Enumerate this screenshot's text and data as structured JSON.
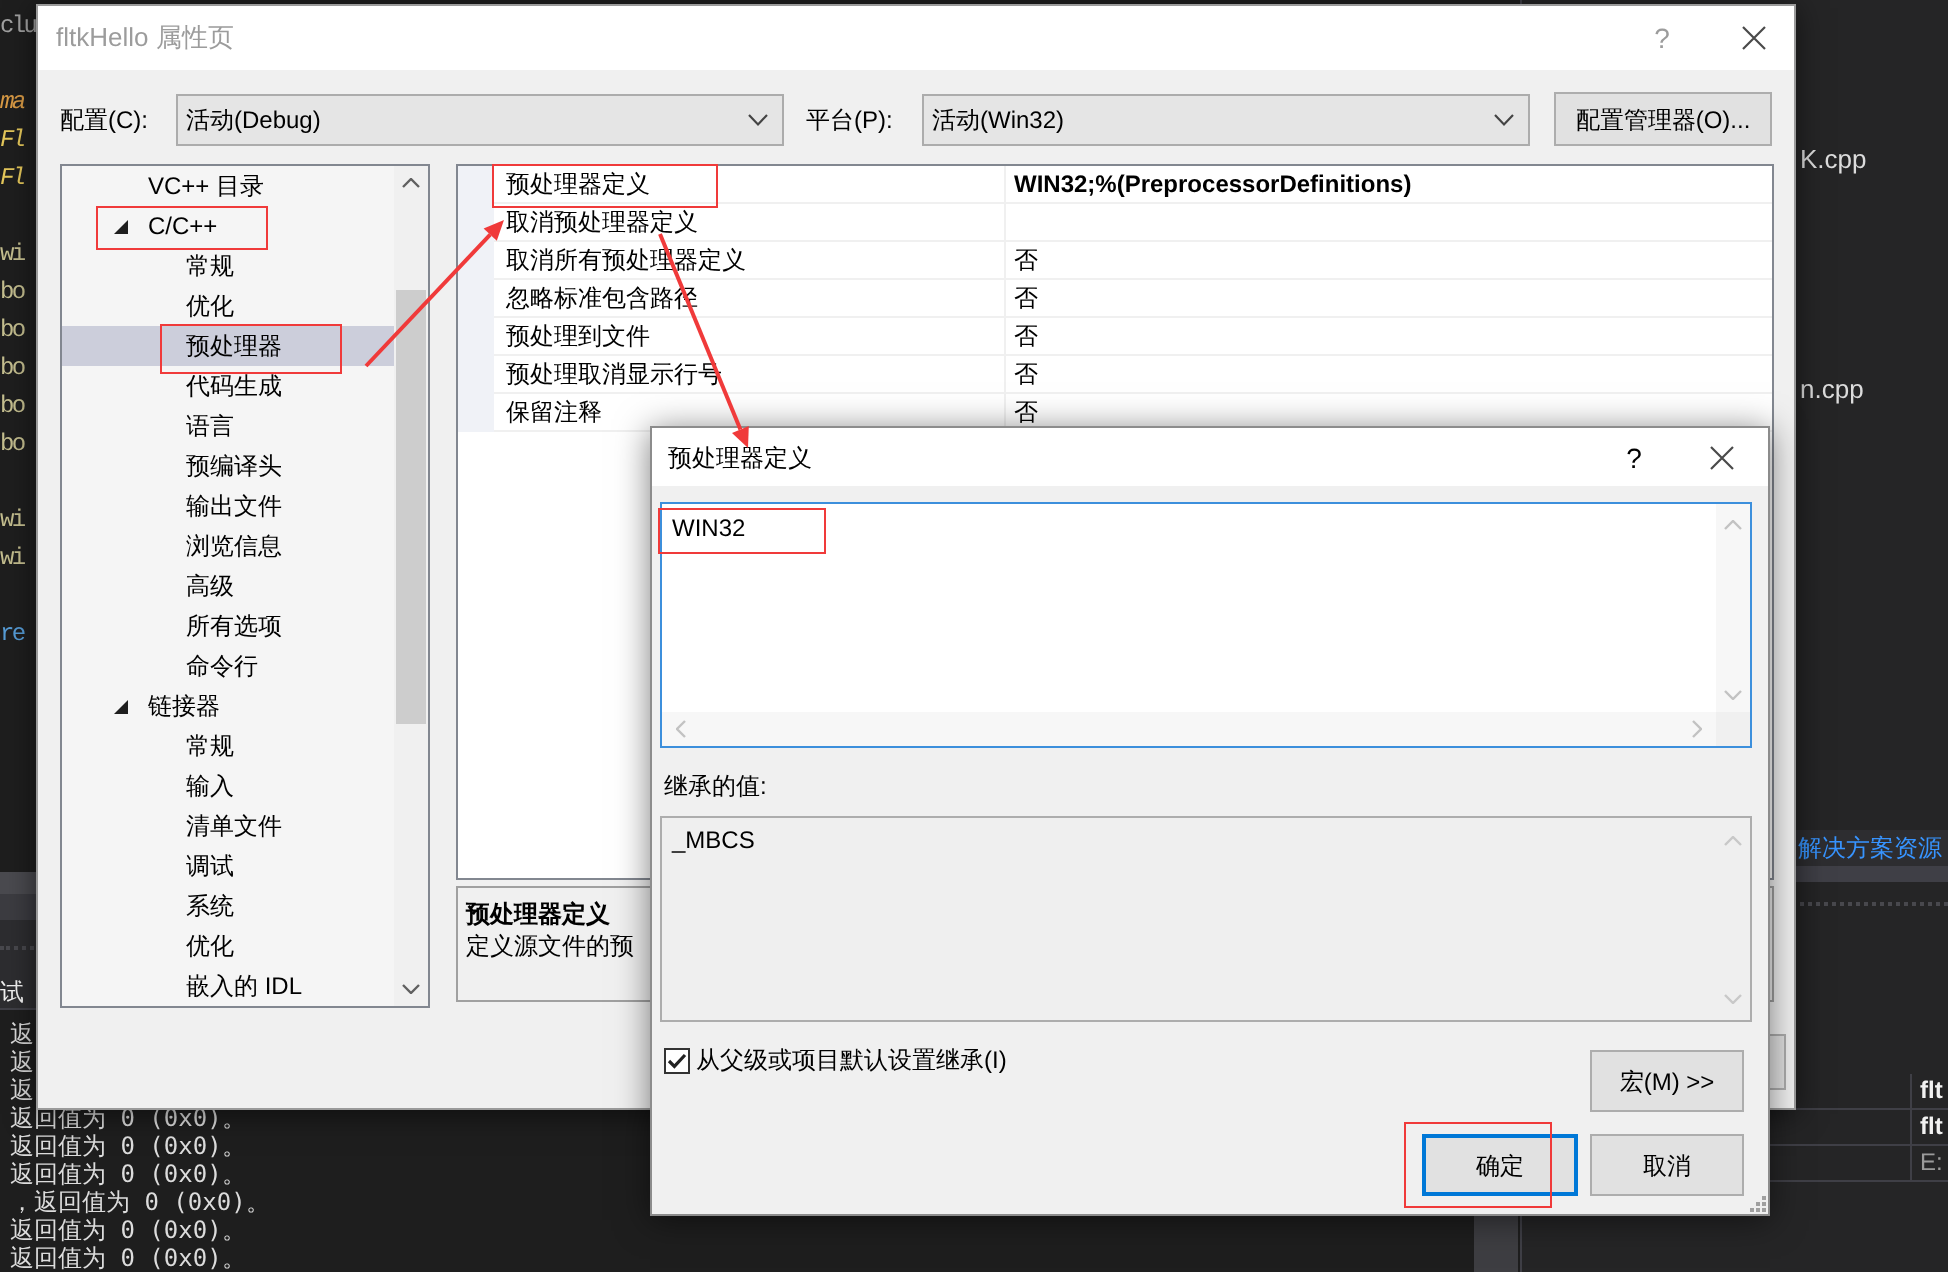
{
  "ide": {
    "code_blocks": [
      [
        {
          "text": "clu",
          "kind": "directive"
        }
      ],
      [
        {
          "text": "ma",
          "kind": "macro"
        },
        {
          "text": "Fl",
          "kind": "call"
        },
        {
          "text": "Fl",
          "kind": "call"
        }
      ],
      [
        {
          "text": "wi",
          "kind": "plain"
        },
        {
          "text": "bo",
          "kind": "plain"
        },
        {
          "text": "bo",
          "kind": "plain"
        },
        {
          "text": "bo",
          "kind": "plain"
        },
        {
          "text": "bo",
          "kind": "plain"
        },
        {
          "text": "bo",
          "kind": "plain"
        }
      ],
      [
        {
          "text": "wi",
          "kind": "plain"
        },
        {
          "text": "wi",
          "kind": "plain"
        }
      ],
      [
        {
          "text": "re",
          "kind": "keyword"
        }
      ]
    ],
    "output_tab": "试",
    "output_lines": [
      "返",
      "返",
      "返",
      "返回值为 0 (0x0)。",
      "返回值为 0 (0x0)。",
      "返回值为 0 (0x0)。",
      "，返回值为 0 (0x0)。",
      "返回值为 0 (0x0)。",
      "返回值为 0 (0x0)。"
    ],
    "files": [
      "K.cpp",
      "n.cpp"
    ],
    "explorer_tab": "解决方案资源",
    "property_rows": [
      {
        "text": "flt",
        "kind": "header"
      },
      {
        "text": "flt",
        "kind": "header"
      },
      {
        "text": "E:",
        "kind": "path"
      }
    ]
  },
  "property_pages": {
    "title": "fltkHello 属性页",
    "help": "?",
    "configuration": {
      "label": "配置(C):",
      "value": "活动(Debug)"
    },
    "platform": {
      "label": "平台(P):",
      "value": "活动(Win32)"
    },
    "manager_button": "配置管理器(O)...",
    "tree": [
      {
        "label": "VC++ 目录",
        "selected": false
      },
      {
        "label": "C/C++",
        "expanded": true,
        "selected": false,
        "children": [
          {
            "label": "常规",
            "selected": false
          },
          {
            "label": "优化",
            "selected": false
          },
          {
            "label": "预处理器",
            "selected": true
          },
          {
            "label": "代码生成",
            "selected": false
          },
          {
            "label": "语言",
            "selected": false
          },
          {
            "label": "预编译头",
            "selected": false
          },
          {
            "label": "输出文件",
            "selected": false
          },
          {
            "label": "浏览信息",
            "selected": false
          },
          {
            "label": "高级",
            "selected": false
          },
          {
            "label": "所有选项",
            "selected": false
          },
          {
            "label": "命令行",
            "selected": false
          }
        ]
      },
      {
        "label": "链接器",
        "expanded": true,
        "selected": false,
        "children": [
          {
            "label": "常规",
            "selected": false
          },
          {
            "label": "输入",
            "selected": false
          },
          {
            "label": "清单文件",
            "selected": false
          },
          {
            "label": "调试",
            "selected": false
          },
          {
            "label": "系统",
            "selected": false
          },
          {
            "label": "优化",
            "selected": false
          },
          {
            "label": "嵌入的 IDL",
            "selected": false
          }
        ]
      }
    ],
    "properties": [
      {
        "name": "预处理器定义",
        "value": "WIN32;%(PreprocessorDefinitions)",
        "modified": true
      },
      {
        "name": "取消预处理器定义"
      },
      {
        "name": "取消所有预处理器定义",
        "value": "否",
        "modified": false
      },
      {
        "name": "忽略标准包含路径",
        "value": "否",
        "modified": false
      },
      {
        "name": "预处理到文件",
        "value": "否",
        "modified": false
      },
      {
        "name": "预处理取消显示行号",
        "value": "否",
        "modified": false
      },
      {
        "name": "保留注释",
        "value": "否",
        "modified": false
      }
    ],
    "description": {
      "title": "预处理器定义",
      "text": "定义源文件的预"
    }
  },
  "definitions_dialog": {
    "title": "预处理器定义",
    "help": "?",
    "value": "WIN32",
    "inherited_label": "继承的值:",
    "inherited_value": "_MBCS",
    "inherit": {
      "label": "从父级或项目默认设置继承(I)",
      "checked": true
    },
    "macros_button": "宏(M) >>",
    "buttons": [
      {
        "label": "确定",
        "default": true
      },
      {
        "label": "取消",
        "default": false
      }
    ]
  }
}
